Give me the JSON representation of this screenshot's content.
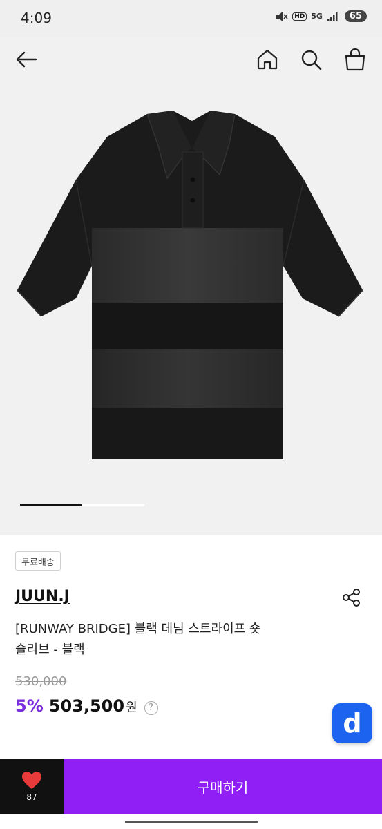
{
  "status": {
    "time": "4:09",
    "hd": "HD",
    "network": "5G",
    "battery": "65"
  },
  "header": {
    "back_icon": "arrow-left-icon",
    "home_icon": "home-icon",
    "search_icon": "search-icon",
    "bag_icon": "shopping-bag-icon"
  },
  "gallery": {
    "image": "black denim striped polo shirt",
    "slide_progress": 0.5
  },
  "product": {
    "badge": "무료배송",
    "brand": "JUUN.J",
    "title_line1": "[RUNWAY BRIDGE] 블랙 데님 스트라이프 숏",
    "title_line2": "슬리브 - 블랙",
    "original_price": "530,000",
    "discount": "5%",
    "price": "503,500",
    "currency": "원",
    "help_icon": "?",
    "fab_label": "d"
  },
  "actions": {
    "like_count": "87",
    "buy_label": "구매하기"
  },
  "colors": {
    "accent": "#8f1ff5",
    "discount": "#7a2ee0",
    "fab": "#1c63f0",
    "like_heart": "#e83a3a"
  }
}
